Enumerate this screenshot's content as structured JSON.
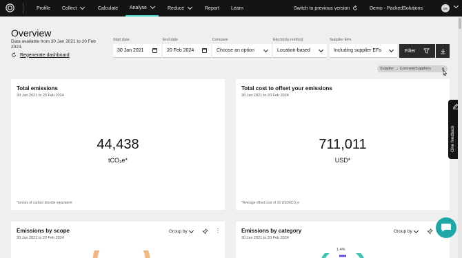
{
  "nav": {
    "items": [
      {
        "label": "Profile"
      },
      {
        "label": "Collect"
      },
      {
        "label": "Calculate"
      },
      {
        "label": "Analyse"
      },
      {
        "label": "Reduce"
      },
      {
        "label": "Report"
      },
      {
        "label": "Learn"
      }
    ],
    "active": "Analyse",
    "switch_label": "Switch to previous version",
    "org_label": "Demo - PackedSolutions",
    "avatar_initials": "DS"
  },
  "header": {
    "title": "Overview",
    "data_range": "Data available from 30 Jan 2021 to 20 Feb 2024.",
    "regenerate_label": "Regenerate dashboard"
  },
  "filters": {
    "start_date_label": "Start date",
    "start_date_value": "30 Jan 2021",
    "end_date_label": "End date",
    "end_date_value": "20 Feb 2024",
    "compare_label": "Compare",
    "compare_placeholder": "Choose an option",
    "electricity_label": "Electricity method",
    "electricity_value": "Location-based",
    "supplier_label": "Supplier EFs",
    "supplier_value": "Including supplier EFs",
    "filter_button": "Filter"
  },
  "active_chip": "Supplier → ConcreteSuppliers",
  "cards": {
    "total_emissions": {
      "title": "Total emissions",
      "subtitle": "30 Jan 2021 to 20 Feb 2024",
      "value": "44,438",
      "unit": "tCO₂e*",
      "footnote": "*tonnes of carbon dioxide equivalent"
    },
    "offset_cost": {
      "title": "Total cost to offset your emissions",
      "subtitle": "30 Jan 2021 to 20 Feb 2024",
      "value": "711,011",
      "unit": "USD*",
      "footnote": "*Average offset cost of 16 USD/tCO₂e"
    },
    "by_scope": {
      "title": "Emissions by scope",
      "subtitle": "30 Jan 2021 to 20 Feb 2024",
      "group_by": "Group by"
    },
    "by_category": {
      "title": "Emissions by category",
      "subtitle": "30 Jan 2021 to 20 Feb 2024",
      "group_by": "Group by",
      "slice_label": "1.4%"
    }
  },
  "feedback_label": "Give feedback",
  "colors": {
    "nav_bg": "#141414",
    "accent": "#3dd6c8",
    "chat": "#1fa8a8",
    "scope_arc": "#f5b880",
    "category_arc": "#3dc6b4"
  }
}
